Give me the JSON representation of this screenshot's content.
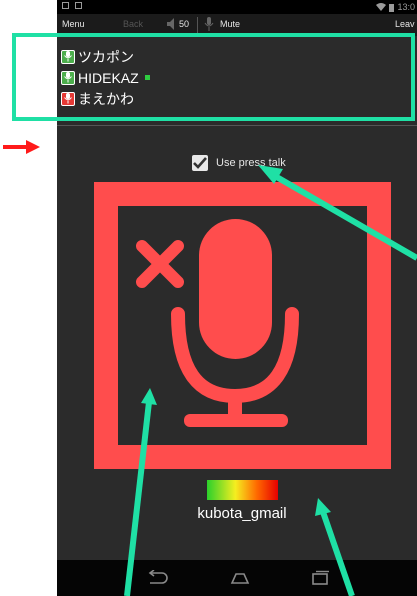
{
  "status_bar": {
    "time": "13:0"
  },
  "action_bar": {
    "menu_label": "Menu",
    "back_label": "Back",
    "volume_value": "50",
    "mute_label": "Mute",
    "leave_label": "Leav"
  },
  "participants": [
    {
      "name": "ツカポン",
      "mic_status": "on"
    },
    {
      "name": "HIDEKAZ",
      "mic_status": "on",
      "speaking": true
    },
    {
      "name": "まえかわ",
      "mic_status": "off"
    }
  ],
  "press_talk": {
    "label": "Use press talk",
    "checked": true
  },
  "mic_button": {
    "state": "muted",
    "color": "#ff4d4d"
  },
  "level_meter": {
    "colors": [
      "#2bd02b",
      "#f5ee20",
      "#ff6a00",
      "#e60000"
    ]
  },
  "user": {
    "name": "kubota_gmail"
  },
  "nav_bar": {
    "icons": [
      "back-icon",
      "home-icon",
      "recent-apps-icon"
    ]
  },
  "annotation_colors": {
    "highlight": "#1fe0a5",
    "pointer": "#ff1a1a"
  }
}
